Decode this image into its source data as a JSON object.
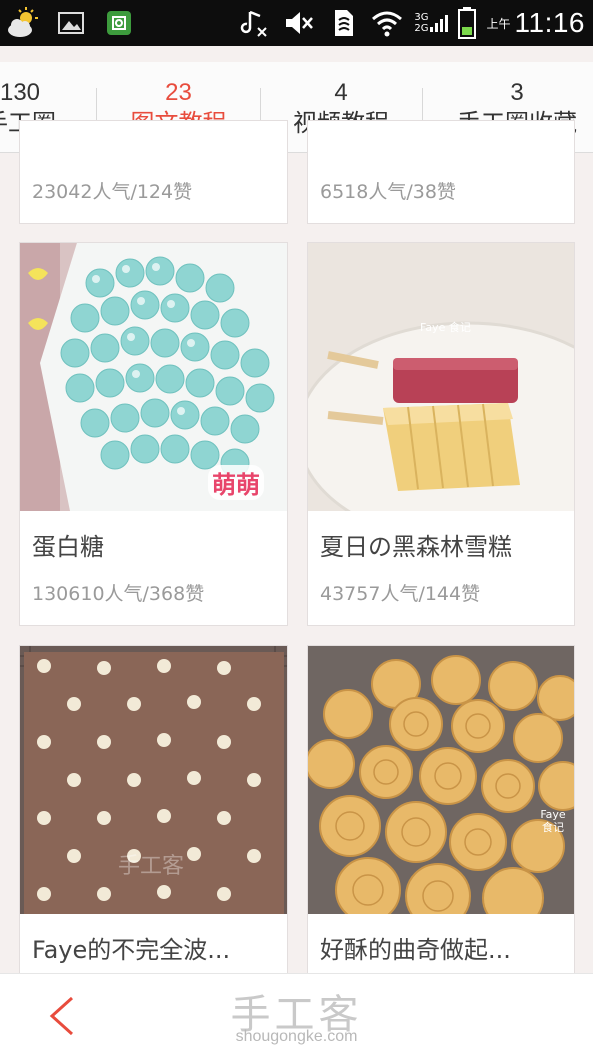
{
  "status_bar": {
    "time": "11:16",
    "ampm": "上午",
    "network_top": "3G",
    "network_bottom": "2G"
  },
  "tabs": [
    {
      "count": "130",
      "label": "手工圈",
      "active": false
    },
    {
      "count": "23",
      "label": "图文教程",
      "active": true
    },
    {
      "count": "4",
      "label": "视频教程",
      "active": false
    },
    {
      "count": "3",
      "label": "手工圈收藏",
      "active": false
    }
  ],
  "cards": [
    {
      "title": "",
      "stats": "23042人气/124赞"
    },
    {
      "title": "",
      "stats": "6518人气/38赞"
    },
    {
      "title": "蛋白糖",
      "stats": "130610人气/368赞",
      "overlay": "萌萌"
    },
    {
      "title": "夏日の黑森林雪糕",
      "stats": "43757人气/144赞",
      "watermark": "Faye 食记"
    },
    {
      "title": "Faye的不完全波...",
      "stats": "",
      "watermark": "手工客"
    },
    {
      "title": "好酥的曲奇做起...",
      "stats": "",
      "watermark": "Faye 食记"
    }
  ],
  "bottom_bar": {
    "brand": "手工客",
    "domain": "shougongke.com"
  },
  "colors": {
    "accent": "#e84c3d",
    "background": "#f5f0ef"
  }
}
